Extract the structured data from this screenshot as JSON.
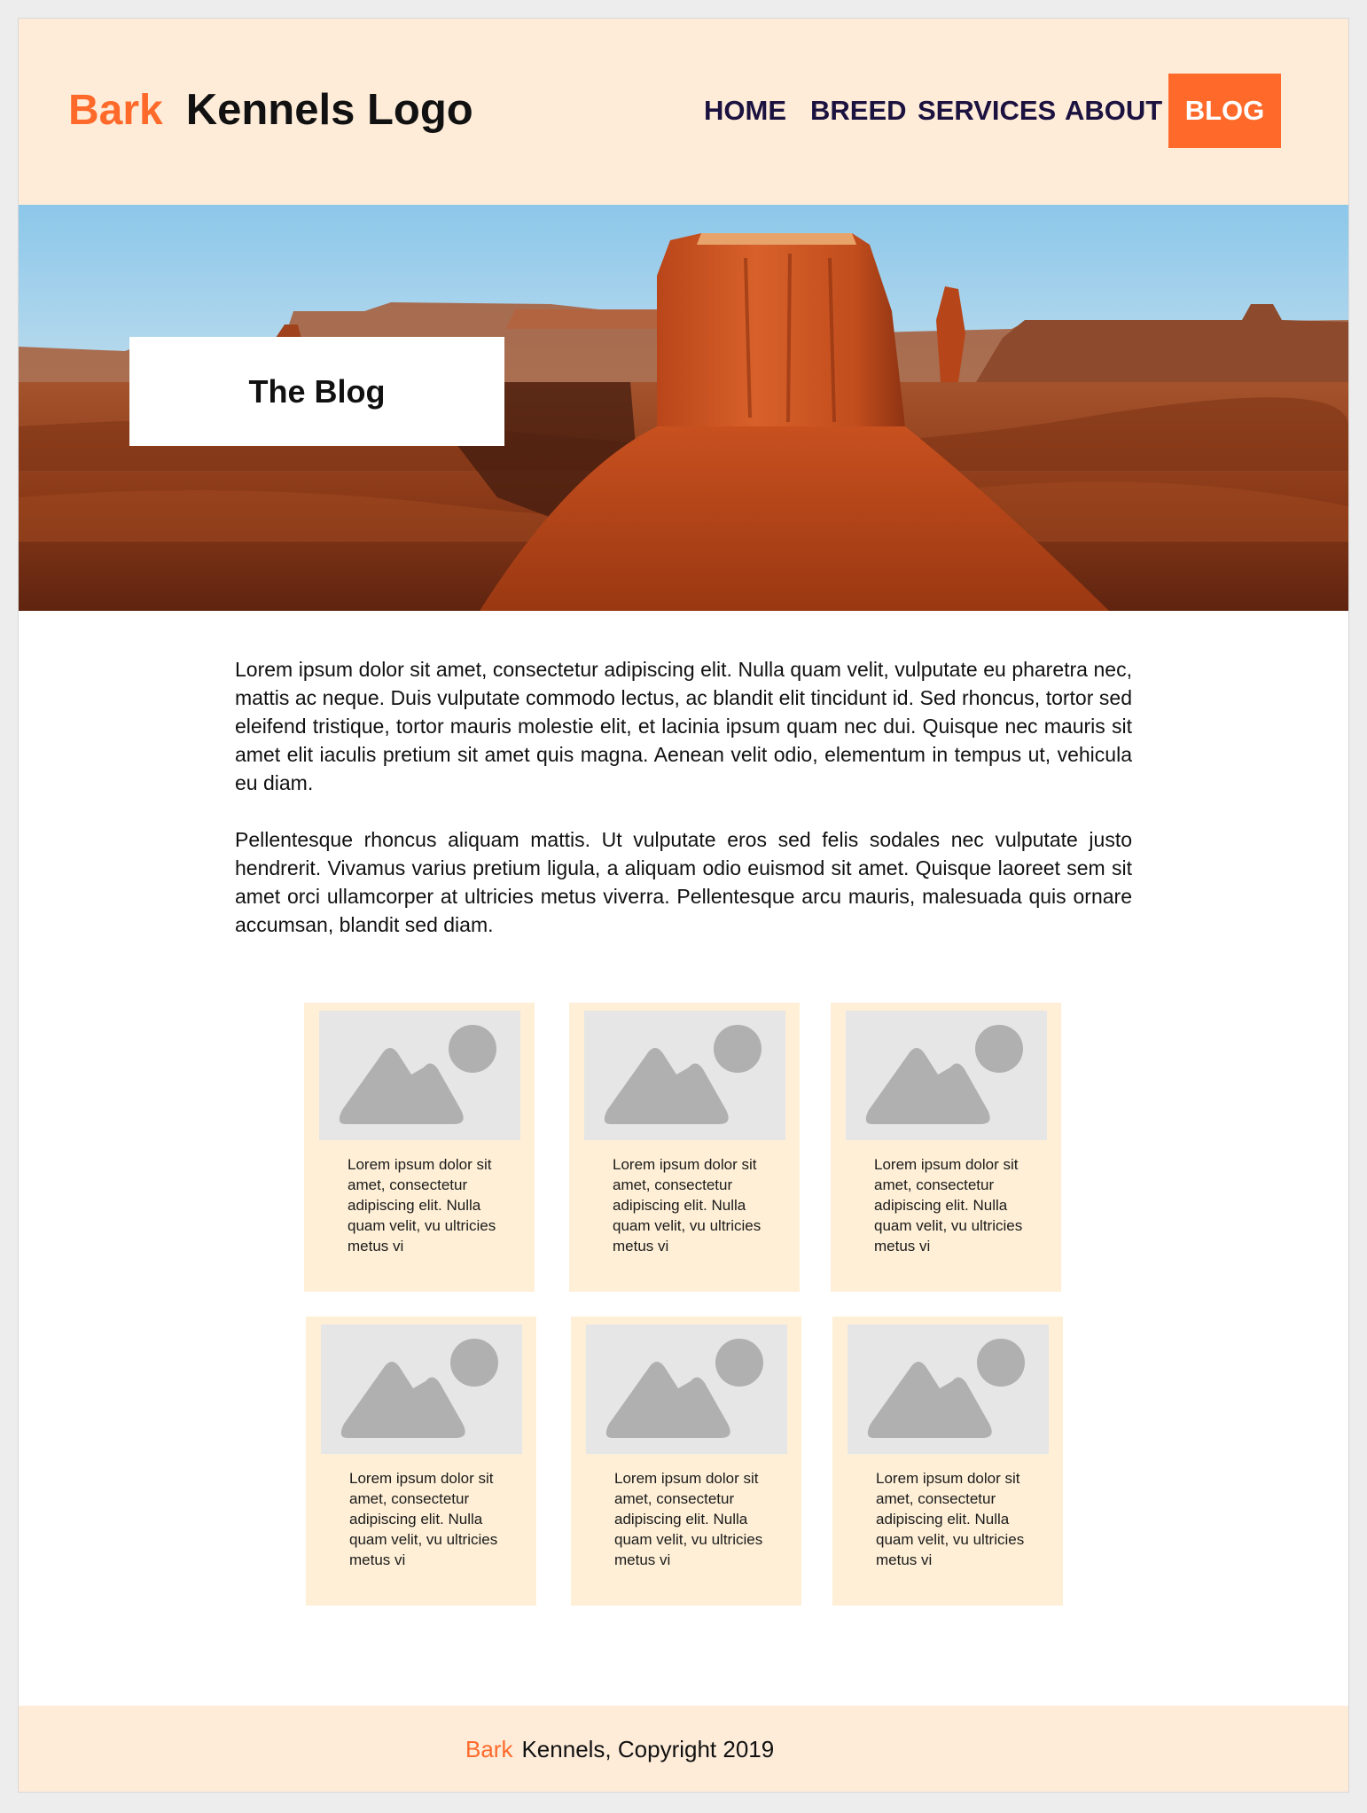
{
  "header": {
    "logo_bark": "Bark",
    "logo_rest": "Kennels Logo",
    "nav": [
      {
        "label": "HOME"
      },
      {
        "label": "BREED"
      },
      {
        "label": "SERVICES"
      },
      {
        "label": "ABOUT"
      },
      {
        "label": "BLOG",
        "active": true
      }
    ]
  },
  "hero": {
    "title": "The Blog",
    "image_icon": "desert-butte-photo"
  },
  "content": {
    "paragraphs": [
      "Lorem ipsum dolor sit amet, consectetur adipiscing elit. Nulla quam velit, vulputate eu pharetra nec, mattis ac neque. Duis vulputate commodo lectus, ac blandit elit tincidunt id. Sed rhoncus, tortor sed eleifend tristique, tortor mauris molestie elit, et lacinia ipsum quam nec dui. Quisque nec mauris sit amet elit iaculis pretium sit amet quis magna. Aenean velit odio, elementum in tempus ut, vehicula eu diam.",
      "Pellentesque rhoncus aliquam mattis. Ut vulputate eros sed felis sodales nec vulputate justo hendrerit. Vivamus varius pretium ligula, a aliquam odio euismod sit amet. Quisque laoreet sem sit amet orci ullamcorper at ultricies metus viverra. Pellentesque arcu mauris, malesuada quis ornare accumsan, blandit sed diam."
    ]
  },
  "cards": [
    {
      "text": "Lorem ipsum dolor sit amet, consectetur adipiscing elit. Nulla quam velit, vu ultricies metus vi",
      "icon": "image-placeholder-icon"
    },
    {
      "text": "Lorem ipsum dolor sit amet, consectetur adipiscing elit. Nulla quam velit, vu ultricies metus vi",
      "icon": "image-placeholder-icon"
    },
    {
      "text": "Lorem ipsum dolor sit amet, consectetur adipiscing elit. Nulla quam velit, vu ultricies metus vi",
      "icon": "image-placeholder-icon"
    },
    {
      "text": "Lorem ipsum dolor sit amet, consectetur adipiscing elit. Nulla quam velit, vu ultricies metus vi",
      "icon": "image-placeholder-icon"
    },
    {
      "text": "Lorem ipsum dolor sit amet, consectetur adipiscing elit. Nulla quam velit, vu ultricies metus vi",
      "icon": "image-placeholder-icon"
    },
    {
      "text": "Lorem ipsum dolor sit amet, consectetur adipiscing elit. Nulla quam velit, vu ultricies metus vi",
      "icon": "image-placeholder-icon"
    }
  ],
  "footer": {
    "bark": "Bark",
    "rest": "Kennels, Copyright 2019"
  },
  "colors": {
    "accent": "#ff6a2b",
    "header_bg": "#feecd9",
    "card_bg": "#feefd6",
    "nav_text": "#1b1240",
    "placeholder_bg": "#e6e6e6",
    "placeholder_shape": "#b0b0b0"
  }
}
